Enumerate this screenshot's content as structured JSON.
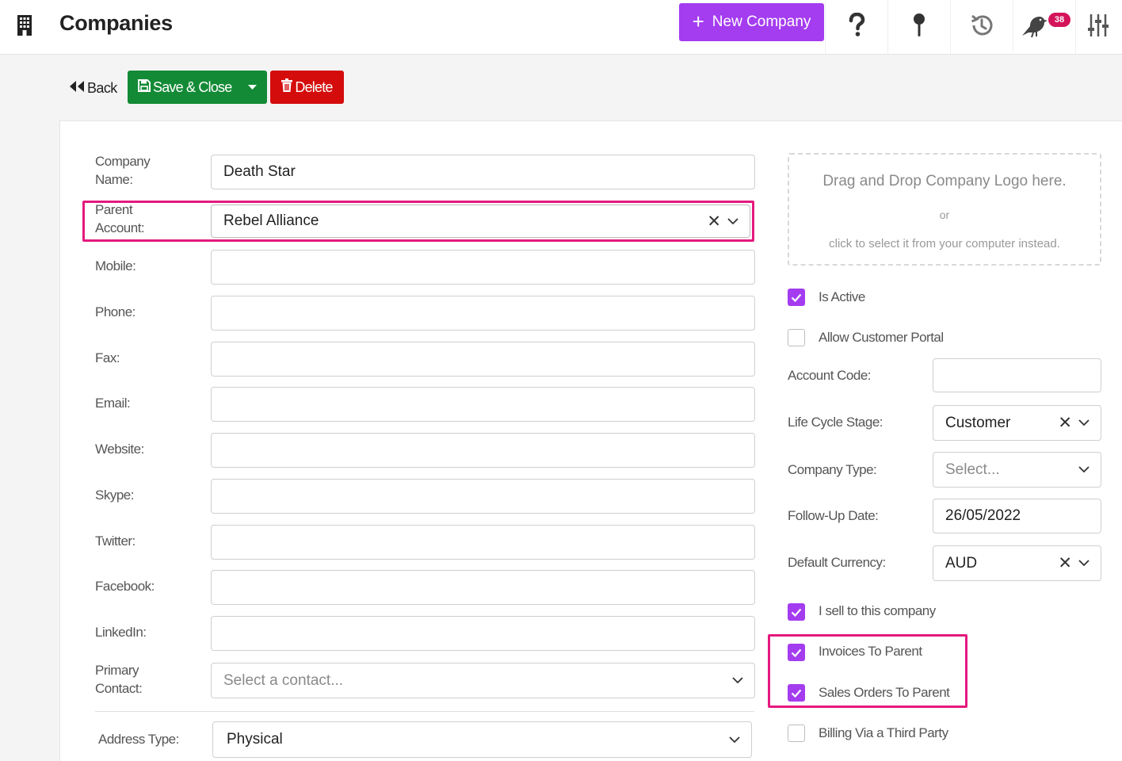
{
  "header": {
    "title": "Companies",
    "new_button_label": "New Company",
    "notification_count": "38",
    "accent_color": "#a43cf0"
  },
  "actions": {
    "back_label": "Back",
    "save_label": "Save & Close",
    "delete_label": "Delete"
  },
  "form": {
    "company_name": {
      "label": "Company Name:",
      "value": "Death Star"
    },
    "parent_account": {
      "label": "Parent Account:",
      "value": "Rebel Alliance"
    },
    "mobile": {
      "label": "Mobile:",
      "value": ""
    },
    "phone": {
      "label": "Phone:",
      "value": ""
    },
    "fax": {
      "label": "Fax:",
      "value": ""
    },
    "email": {
      "label": "Email:",
      "value": ""
    },
    "website": {
      "label": "Website:",
      "value": ""
    },
    "skype": {
      "label": "Skype:",
      "value": ""
    },
    "twitter": {
      "label": "Twitter:",
      "value": ""
    },
    "facebook": {
      "label": "Facebook:",
      "value": ""
    },
    "linkedin": {
      "label": "LinkedIn:",
      "value": ""
    },
    "primary_contact": {
      "label": "Primary Contact:",
      "placeholder": "Select a contact..."
    },
    "address_type": {
      "label": "Address Type:",
      "value": "Physical"
    }
  },
  "logo": {
    "line1": "Drag and Drop Company Logo here.",
    "line2": "or",
    "line3": "click to select it from your computer instead."
  },
  "options": {
    "is_active": {
      "label": "Is Active",
      "checked": true
    },
    "allow_customer_portal": {
      "label": "Allow Customer Portal",
      "checked": false
    },
    "i_sell": {
      "label": "I sell to this company",
      "checked": true
    },
    "invoices_to_parent": {
      "label": "Invoices To Parent",
      "checked": true
    },
    "sales_orders_to_parent": {
      "label": "Sales Orders To Parent",
      "checked": true
    },
    "billing_third_party": {
      "label": "Billing Via a Third Party",
      "checked": false
    }
  },
  "side": {
    "account_code": {
      "label": "Account Code:",
      "value": ""
    },
    "life_cycle_stage": {
      "label": "Life Cycle Stage:",
      "value": "Customer"
    },
    "company_type": {
      "label": "Company Type:",
      "placeholder": "Select..."
    },
    "follow_up_date": {
      "label": "Follow-Up Date:",
      "value": "26/05/2022"
    },
    "default_currency": {
      "label": "Default Currency:",
      "value": "AUD"
    }
  },
  "icons": [
    "building-icon",
    "plus-icon",
    "help-icon",
    "pin-icon",
    "history-icon",
    "bird-icon",
    "sliders-icon",
    "back-icon",
    "save-icon",
    "chevron-down-icon",
    "trash-icon",
    "clear-icon",
    "check-icon"
  ]
}
